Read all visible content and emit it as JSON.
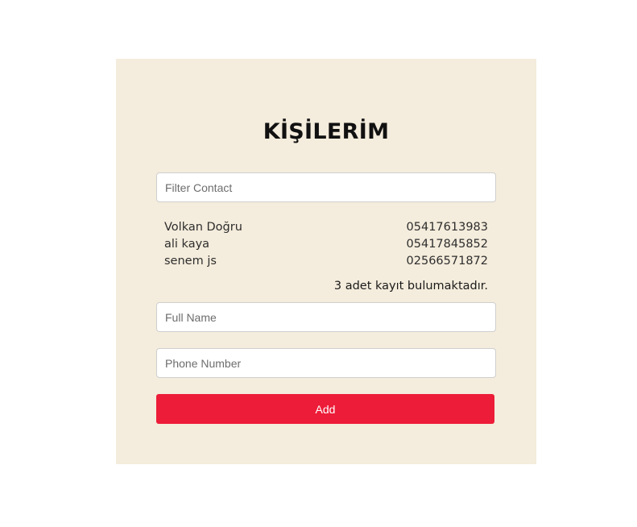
{
  "app": {
    "title": "KİŞİLERİM"
  },
  "filter": {
    "placeholder": "Filter Contact",
    "value": ""
  },
  "contacts": [
    {
      "name": "Volkan Doğru",
      "phone": "05417613983"
    },
    {
      "name": "ali kaya",
      "phone": "05417845852"
    },
    {
      "name": "senem js",
      "phone": "02566571872"
    }
  ],
  "summary": {
    "count_text": "3 adet kayıt bulumaktadır."
  },
  "form": {
    "fullname_placeholder": "Full Name",
    "phone_placeholder": "Phone Number",
    "add_label": "Add"
  },
  "colors": {
    "card_background": "#f4ecdc",
    "button_background": "#ed1c38"
  }
}
